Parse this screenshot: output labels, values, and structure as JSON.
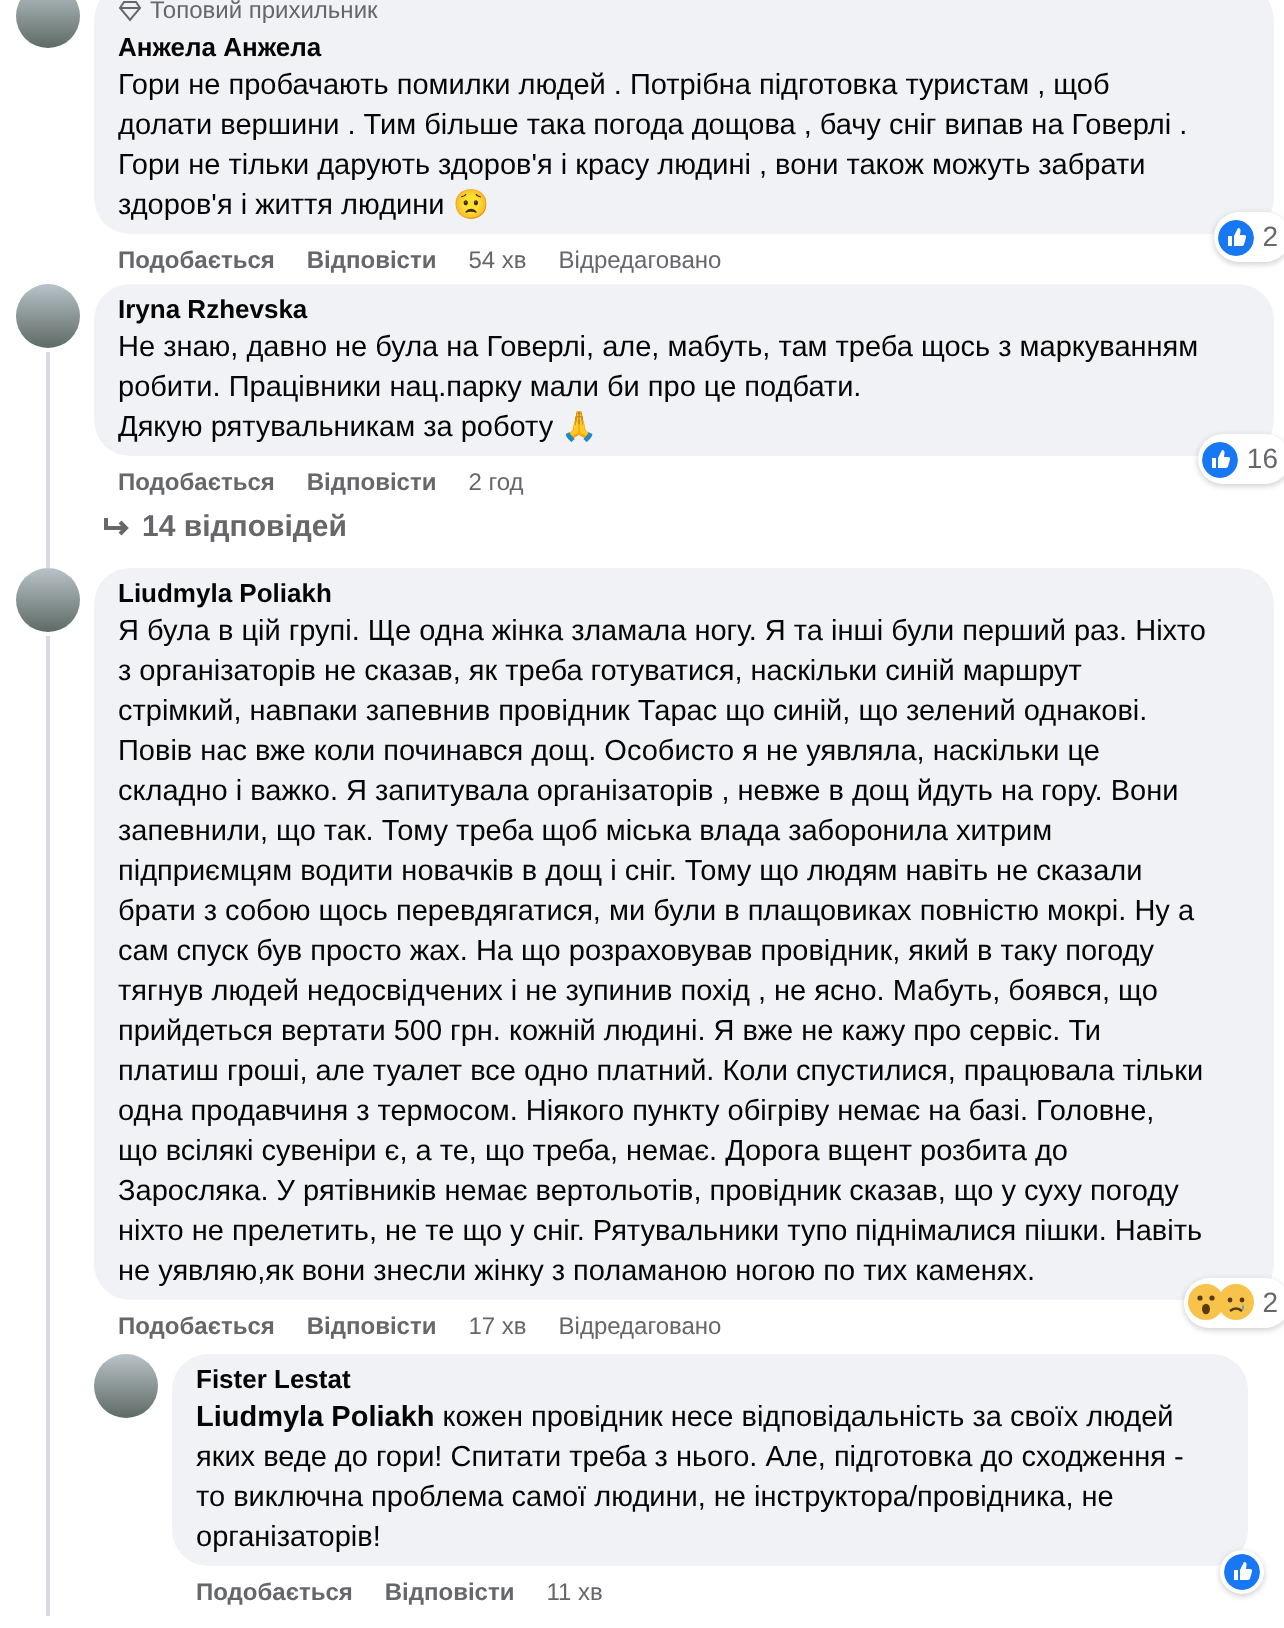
{
  "comments": [
    {
      "badge": "Топовий прихильник",
      "author": "Анжела Анжела",
      "lines": [
        "Гори не пробачають помилки людей . Потрібна підготовка туристам , щоб",
        "долати вершини . Тим більше така погода дощова , бачу сніг випав на Говерлі .",
        "Гори не тільки дарують здоров'я і красу людині , вони також можуть забрати",
        "здоров'я і життя людини 😟"
      ],
      "like": "Подобається",
      "reply": "Відповісти",
      "time": "54 хв",
      "edited": "Відредаговано",
      "reactions": [
        {
          "kind": "like"
        }
      ],
      "reaction_count": "2"
    },
    {
      "author": "Iryna Rzhevska",
      "lines": [
        "Не знаю, давно не була на Говерлі, але, мабуть, там треба щось з маркуванням",
        "робити. Працівники нац.парку мали би про це подбати.",
        "Дякую рятувальникам за роботу 🙏"
      ],
      "like": "Подобається",
      "reply": "Відповісти",
      "time": "2 год",
      "reactions": [
        {
          "kind": "like"
        }
      ],
      "reaction_count": "16",
      "replies_link": "14 відповідей"
    },
    {
      "author": "Liudmyla Poliakh",
      "lines": [
        "Я була в цій групі. Ще одна жінка зламала ногу. Я та інші були перший раз. Ніхто",
        "з організаторів не сказав, як треба готуватися, наскільки синій маршрут",
        "стрімкий, навпаки запевнив провідник Тарас що синій, що зелений однакові.",
        "Повів нас вже коли починався дощ. Особисто я не уявляла, наскільки це",
        "складно і важко. Я запитувала організаторів , невже в дощ йдуть на гору. Вони",
        "запевнили, що так. Тому треба щоб міська влада заборонила хитрим",
        "підприємцям водити новачків в дощ і сніг. Тому що людям навіть не сказали",
        "брати з собою щось перевдягатися, ми були в плащовиках повністю мокрі. Ну а",
        "сам спуск був просто жах. На що розраховував провідник, який в таку погоду",
        "тягнув людей недосвідчених і не зупинив похід , не ясно. Мабуть, боявся, що",
        "прийдеться вертати 500 грн. кожній людині. Я вже не кажу про сервіс. Ти",
        "платиш гроші, але туалет все одно платний. Коли спустилися, працювала тільки",
        "одна продавчиня з термосом. Ніякого пункту обігріву немає на базі. Головне,",
        "що всілякі сувеніри є, а те, що треба, немає. Дорога вщент розбита до",
        "Заросляка. У рятівників немає вертольотів, провідник сказав, що у суху погоду",
        "ніхто не прелетить, не те що у сніг. Рятувальники тупо піднімалися пішки. Навіть",
        "не уявляю,як вони знесли жінку з поламаною ногою по тих каменях."
      ],
      "like": "Подобається",
      "reply": "Відповісти",
      "time": "17 хв",
      "edited": "Відредаговано",
      "reactions": [
        {
          "kind": "wow"
        },
        {
          "kind": "sad"
        }
      ],
      "reaction_count": "2",
      "children": [
        {
          "author": "Fister Lestat",
          "lines": [
            "**Liudmyla Poliakh** кожен провідник несе відповідальність за своїх людей",
            "яких веде до гори! Спитати треба з нього. Але, підготовка до сходження -",
            "то виключна проблема самої людини, не інструктора/провідника, не",
            "організаторів!"
          ],
          "like": "Подобається",
          "reply": "Відповісти",
          "time": "11 хв",
          "reactions": [
            {
              "kind": "like"
            }
          ]
        }
      ]
    }
  ]
}
